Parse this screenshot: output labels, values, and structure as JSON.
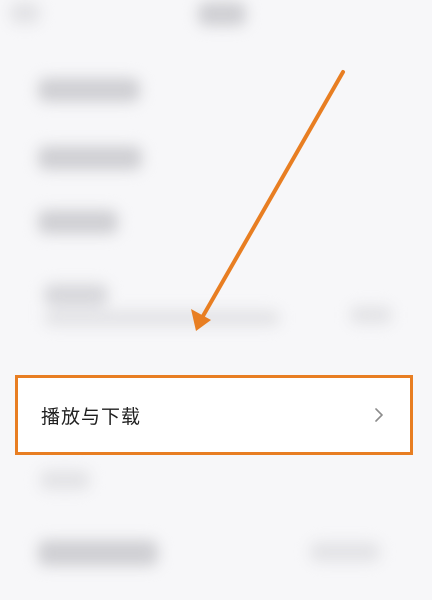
{
  "settings_list": {
    "highlighted_item": {
      "label": "播放与下载"
    }
  },
  "colors": {
    "highlight_border": "#e87e22",
    "arrow": "#e87e22",
    "background": "#f7f7f9",
    "row_background": "#ffffff"
  },
  "icons": {
    "row_chevron": "chevron-right-icon",
    "annotation": "annotation-arrow-icon"
  }
}
